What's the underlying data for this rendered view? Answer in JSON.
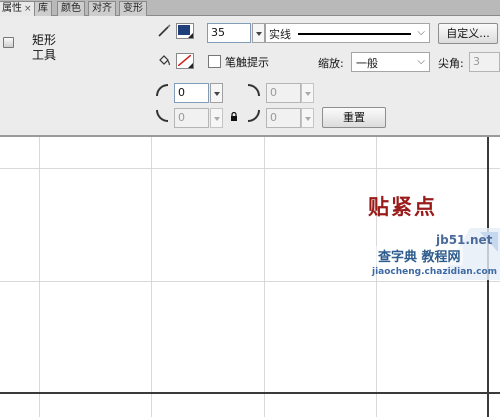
{
  "tabs": [
    {
      "label": "属性",
      "close": "×"
    },
    {
      "label": "库"
    },
    {
      "label": "颜色"
    },
    {
      "label": "对齐"
    },
    {
      "label": "变形"
    }
  ],
  "tool": {
    "name_line1": "矩形",
    "name_line2": "工具",
    "icon": "rectangle-tool-icon"
  },
  "stroke": {
    "pencil_icon": "pencil-icon",
    "color": "#1f3f7a",
    "width_value": "35",
    "style_label": "实线",
    "custom_button": "自定义..."
  },
  "fill": {
    "bucket_icon": "paint-bucket-icon",
    "color": "none"
  },
  "stroke_hinting": {
    "label": "笔触提示",
    "checked": false
  },
  "scale": {
    "label": "缩放:",
    "value": "一般"
  },
  "miter": {
    "label": "尖角:",
    "value": "3"
  },
  "corner_radius": {
    "top_left": "0",
    "bottom_left": "0",
    "top_right": "0",
    "bottom_right": "0",
    "lock_icon": "lock-icon"
  },
  "reset_button": "重置",
  "annotation": "贴紧点",
  "watermark": {
    "line1": "jb51.net",
    "line2": "查字典 教程网",
    "line3": "jiaocheng.chazidian.com"
  },
  "colors": {
    "annotation": "#9b1a1a",
    "stroke_swatch": "#1f3f7a",
    "fill_slash": "#d22020"
  }
}
